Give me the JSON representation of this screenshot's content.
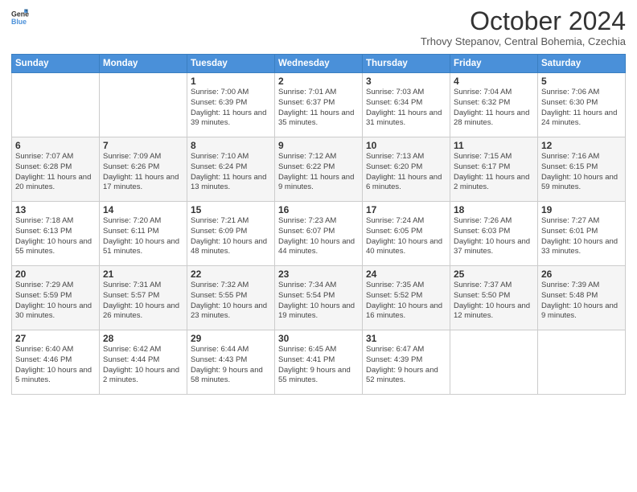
{
  "header": {
    "logo_line1": "General",
    "logo_line2": "Blue",
    "month_title": "October 2024",
    "location": "Trhovy Stepanov, Central Bohemia, Czechia"
  },
  "weekdays": [
    "Sunday",
    "Monday",
    "Tuesday",
    "Wednesday",
    "Thursday",
    "Friday",
    "Saturday"
  ],
  "weeks": [
    [
      {
        "day": "",
        "sunrise": "",
        "sunset": "",
        "daylight": ""
      },
      {
        "day": "",
        "sunrise": "",
        "sunset": "",
        "daylight": ""
      },
      {
        "day": "1",
        "sunrise": "Sunrise: 7:00 AM",
        "sunset": "Sunset: 6:39 PM",
        "daylight": "Daylight: 11 hours and 39 minutes."
      },
      {
        "day": "2",
        "sunrise": "Sunrise: 7:01 AM",
        "sunset": "Sunset: 6:37 PM",
        "daylight": "Daylight: 11 hours and 35 minutes."
      },
      {
        "day": "3",
        "sunrise": "Sunrise: 7:03 AM",
        "sunset": "Sunset: 6:34 PM",
        "daylight": "Daylight: 11 hours and 31 minutes."
      },
      {
        "day": "4",
        "sunrise": "Sunrise: 7:04 AM",
        "sunset": "Sunset: 6:32 PM",
        "daylight": "Daylight: 11 hours and 28 minutes."
      },
      {
        "day": "5",
        "sunrise": "Sunrise: 7:06 AM",
        "sunset": "Sunset: 6:30 PM",
        "daylight": "Daylight: 11 hours and 24 minutes."
      }
    ],
    [
      {
        "day": "6",
        "sunrise": "Sunrise: 7:07 AM",
        "sunset": "Sunset: 6:28 PM",
        "daylight": "Daylight: 11 hours and 20 minutes."
      },
      {
        "day": "7",
        "sunrise": "Sunrise: 7:09 AM",
        "sunset": "Sunset: 6:26 PM",
        "daylight": "Daylight: 11 hours and 17 minutes."
      },
      {
        "day": "8",
        "sunrise": "Sunrise: 7:10 AM",
        "sunset": "Sunset: 6:24 PM",
        "daylight": "Daylight: 11 hours and 13 minutes."
      },
      {
        "day": "9",
        "sunrise": "Sunrise: 7:12 AM",
        "sunset": "Sunset: 6:22 PM",
        "daylight": "Daylight: 11 hours and 9 minutes."
      },
      {
        "day": "10",
        "sunrise": "Sunrise: 7:13 AM",
        "sunset": "Sunset: 6:20 PM",
        "daylight": "Daylight: 11 hours and 6 minutes."
      },
      {
        "day": "11",
        "sunrise": "Sunrise: 7:15 AM",
        "sunset": "Sunset: 6:17 PM",
        "daylight": "Daylight: 11 hours and 2 minutes."
      },
      {
        "day": "12",
        "sunrise": "Sunrise: 7:16 AM",
        "sunset": "Sunset: 6:15 PM",
        "daylight": "Daylight: 10 hours and 59 minutes."
      }
    ],
    [
      {
        "day": "13",
        "sunrise": "Sunrise: 7:18 AM",
        "sunset": "Sunset: 6:13 PM",
        "daylight": "Daylight: 10 hours and 55 minutes."
      },
      {
        "day": "14",
        "sunrise": "Sunrise: 7:20 AM",
        "sunset": "Sunset: 6:11 PM",
        "daylight": "Daylight: 10 hours and 51 minutes."
      },
      {
        "day": "15",
        "sunrise": "Sunrise: 7:21 AM",
        "sunset": "Sunset: 6:09 PM",
        "daylight": "Daylight: 10 hours and 48 minutes."
      },
      {
        "day": "16",
        "sunrise": "Sunrise: 7:23 AM",
        "sunset": "Sunset: 6:07 PM",
        "daylight": "Daylight: 10 hours and 44 minutes."
      },
      {
        "day": "17",
        "sunrise": "Sunrise: 7:24 AM",
        "sunset": "Sunset: 6:05 PM",
        "daylight": "Daylight: 10 hours and 40 minutes."
      },
      {
        "day": "18",
        "sunrise": "Sunrise: 7:26 AM",
        "sunset": "Sunset: 6:03 PM",
        "daylight": "Daylight: 10 hours and 37 minutes."
      },
      {
        "day": "19",
        "sunrise": "Sunrise: 7:27 AM",
        "sunset": "Sunset: 6:01 PM",
        "daylight": "Daylight: 10 hours and 33 minutes."
      }
    ],
    [
      {
        "day": "20",
        "sunrise": "Sunrise: 7:29 AM",
        "sunset": "Sunset: 5:59 PM",
        "daylight": "Daylight: 10 hours and 30 minutes."
      },
      {
        "day": "21",
        "sunrise": "Sunrise: 7:31 AM",
        "sunset": "Sunset: 5:57 PM",
        "daylight": "Daylight: 10 hours and 26 minutes."
      },
      {
        "day": "22",
        "sunrise": "Sunrise: 7:32 AM",
        "sunset": "Sunset: 5:55 PM",
        "daylight": "Daylight: 10 hours and 23 minutes."
      },
      {
        "day": "23",
        "sunrise": "Sunrise: 7:34 AM",
        "sunset": "Sunset: 5:54 PM",
        "daylight": "Daylight: 10 hours and 19 minutes."
      },
      {
        "day": "24",
        "sunrise": "Sunrise: 7:35 AM",
        "sunset": "Sunset: 5:52 PM",
        "daylight": "Daylight: 10 hours and 16 minutes."
      },
      {
        "day": "25",
        "sunrise": "Sunrise: 7:37 AM",
        "sunset": "Sunset: 5:50 PM",
        "daylight": "Daylight: 10 hours and 12 minutes."
      },
      {
        "day": "26",
        "sunrise": "Sunrise: 7:39 AM",
        "sunset": "Sunset: 5:48 PM",
        "daylight": "Daylight: 10 hours and 9 minutes."
      }
    ],
    [
      {
        "day": "27",
        "sunrise": "Sunrise: 6:40 AM",
        "sunset": "Sunset: 4:46 PM",
        "daylight": "Daylight: 10 hours and 5 minutes."
      },
      {
        "day": "28",
        "sunrise": "Sunrise: 6:42 AM",
        "sunset": "Sunset: 4:44 PM",
        "daylight": "Daylight: 10 hours and 2 minutes."
      },
      {
        "day": "29",
        "sunrise": "Sunrise: 6:44 AM",
        "sunset": "Sunset: 4:43 PM",
        "daylight": "Daylight: 9 hours and 58 minutes."
      },
      {
        "day": "30",
        "sunrise": "Sunrise: 6:45 AM",
        "sunset": "Sunset: 4:41 PM",
        "daylight": "Daylight: 9 hours and 55 minutes."
      },
      {
        "day": "31",
        "sunrise": "Sunrise: 6:47 AM",
        "sunset": "Sunset: 4:39 PM",
        "daylight": "Daylight: 9 hours and 52 minutes."
      },
      {
        "day": "",
        "sunrise": "",
        "sunset": "",
        "daylight": ""
      },
      {
        "day": "",
        "sunrise": "",
        "sunset": "",
        "daylight": ""
      }
    ]
  ]
}
